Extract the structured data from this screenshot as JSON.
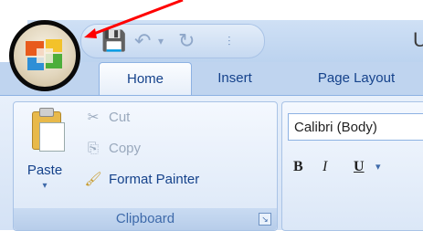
{
  "quick_access": {
    "save_icon": "save-icon",
    "undo_icon": "undo-icon",
    "redo_icon": "redo-icon",
    "customize_icon": "qat-dropdown-icon"
  },
  "title_fragment": "U",
  "tabs": [
    {
      "label": "Home",
      "active": true
    },
    {
      "label": "Insert",
      "active": false
    },
    {
      "label": "Page Layout",
      "active": false
    }
  ],
  "clipboard": {
    "paste_label": "Paste",
    "cut_label": "Cut",
    "copy_label": "Copy",
    "format_painter_label": "Format Painter",
    "group_label": "Clipboard"
  },
  "font": {
    "font_name": "Calibri (Body)",
    "bold_label": "B",
    "italic_label": "I",
    "underline_label": "U"
  },
  "annotation": {
    "arrow_color": "#ff0000",
    "circle_color": "#0a0a0a"
  },
  "colors": {
    "tab_text": "#15428b",
    "ribbon_bg": "#dbe7f7"
  }
}
